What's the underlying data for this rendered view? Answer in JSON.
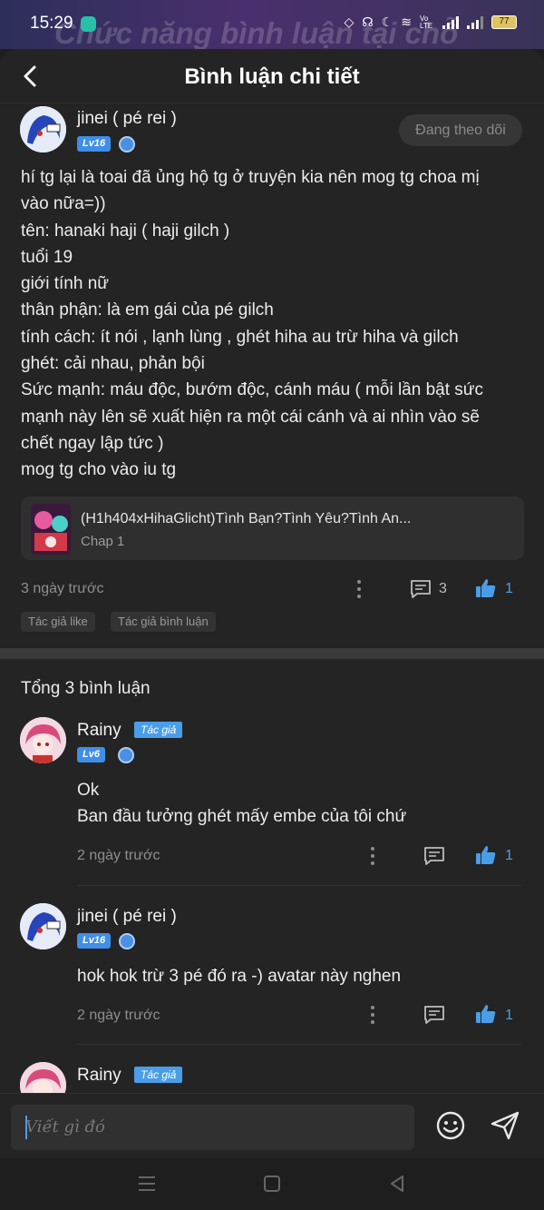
{
  "status_bar": {
    "time": "15:29",
    "battery": "77",
    "net_label": "Vo LTE",
    "background_banner": "Chức năng bình luận tại chỗ"
  },
  "header": {
    "title": "Bình luận chi tiết"
  },
  "post": {
    "username": "jinei ( pé rei )",
    "level": "Lv16",
    "follow_label": "Đang theo dõi",
    "lines": [
      "hí tg lại là toai đã ủng hộ tg ở truyện kia nên mog tg choa mị",
      "vào nữa=))",
      "tên: hanaki haji ( haji gilch )",
      "tuổi 19",
      "giới tính nữ",
      "thân phận: là em gái của pé gilch",
      "tính cách: ít nói , lạnh lùng , ghét hiha au trừ hiha và gilch",
      "ghét: cải nhau, phản bội",
      "Sức mạnh: máu độc, bướm độc, cánh máu ( mỗi lần bật sức",
      "mạnh này lên sẽ xuất hiện ra một cái cánh và ai nhìn vào sẽ",
      "chết ngay lập tức )",
      "mog tg cho vào iu tg"
    ],
    "story": {
      "title": "(H1h404xHihaGlicht)Tình Bạn?Tình Yêu?Tình An...",
      "chapter": "Chap 1"
    },
    "time": "3 ngày trước",
    "comment_count": "3",
    "like_count": "1",
    "chips": [
      "Tác giả like",
      "Tác giả bình luận"
    ]
  },
  "comments_section": {
    "total_label": "Tổng 3 bình luận",
    "items": [
      {
        "username": "Rainy",
        "author_tag": "Tác giả",
        "level": "Lv6",
        "line1": "Ok",
        "line2": "Ban đầu tưởng ghét mấy embe của tôi chứ",
        "time": "2 ngày trước",
        "like_count": "1"
      },
      {
        "username": "jinei ( pé rei )",
        "level": "Lv16",
        "line1": "hok hok trừ 3 pé đó ra -) avatar này nghen",
        "time": "2 ngày trước",
        "like_count": "1"
      },
      {
        "username": "Rainy",
        "author_tag": "Tác giả"
      }
    ]
  },
  "composer": {
    "placeholder": "Viết gì đó"
  },
  "colors": {
    "accent": "#4a9ee8",
    "background": "#242424",
    "level_badge": "#3f8ee8"
  }
}
